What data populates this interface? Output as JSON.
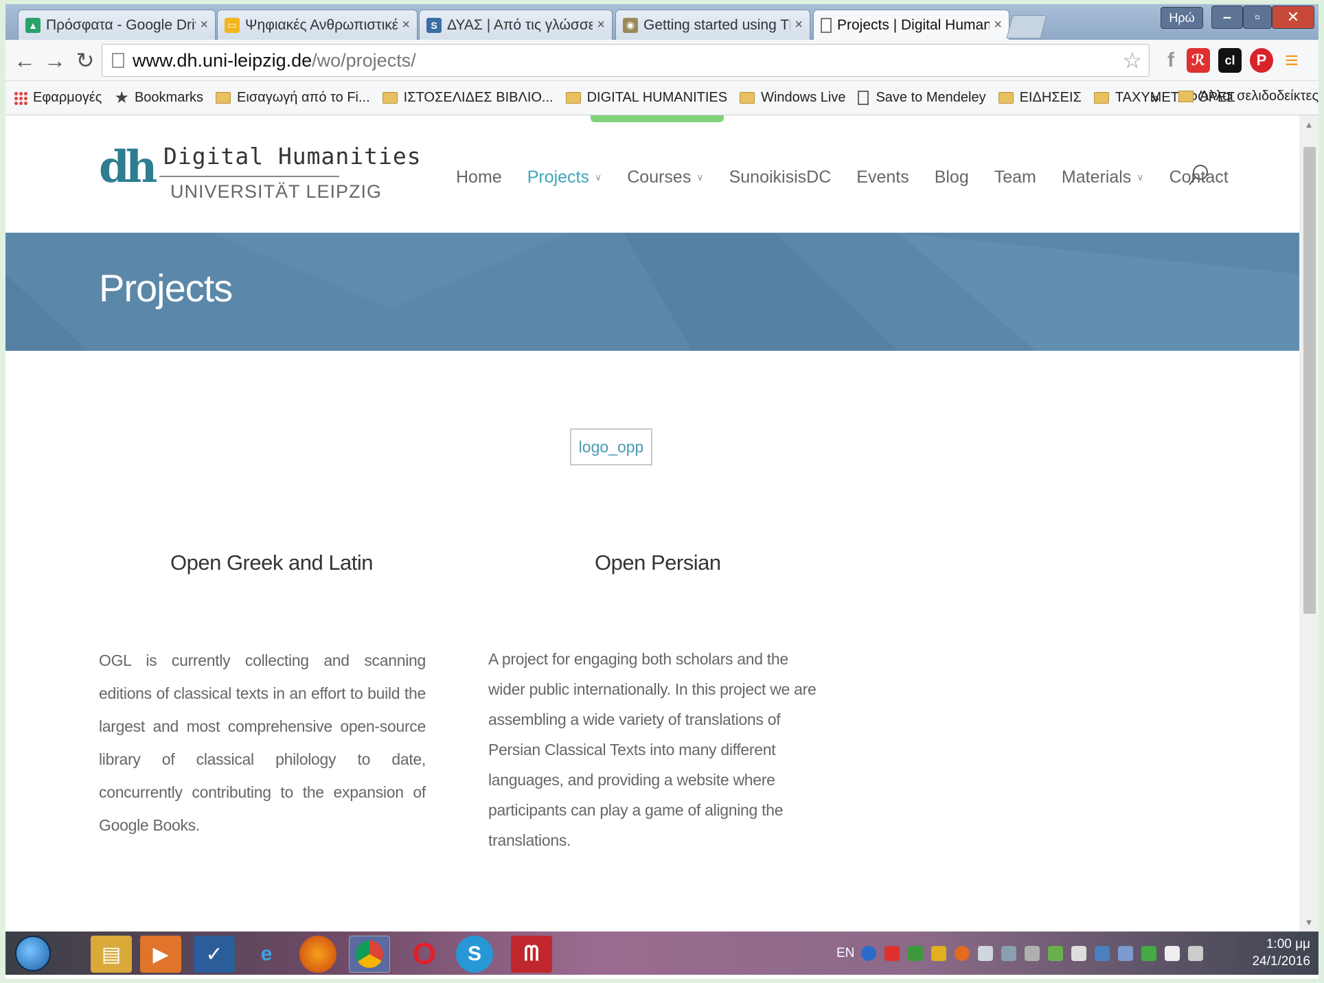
{
  "browser": {
    "tabs": [
      {
        "title": "Πρόσφατα - Google Drive",
        "icon": "google-drive-icon",
        "color": "#2aa26a"
      },
      {
        "title": "Ψηφιακές Ανθρωπιστικές",
        "icon": "slides-icon",
        "color": "#f2b51c"
      },
      {
        "title": "ΔΥΑΣ | Από τις γλώσσες σ",
        "icon": "s-logo-icon",
        "color": "#3b6ea5"
      },
      {
        "title": "Getting started using TEI",
        "icon": "tei-icon",
        "color": "#9a8a5a"
      },
      {
        "title": "Projects | Digital Humaniti",
        "icon": "page-icon",
        "color": "#ffffff"
      }
    ],
    "user_badge": "Ηρώ",
    "address": {
      "host": "www.dh.uni-leipzig.de",
      "path": "/wo/projects/"
    },
    "bookmarks": [
      {
        "label": "Εφαρμογές",
        "icon": "apps-icon"
      },
      {
        "label": "Bookmarks",
        "icon": "star-icon"
      },
      {
        "label": "Εισαγωγή από το Fi...",
        "icon": "folder-icon"
      },
      {
        "label": "ΙΣΤΟΣΕΛΙΔΕΣ ΒΙΒΛΙΟ...",
        "icon": "folder-icon"
      },
      {
        "label": "DIGITAL HUMANITIES",
        "icon": "folder-icon"
      },
      {
        "label": "Windows Live",
        "icon": "folder-icon"
      },
      {
        "label": "Save to Mendeley",
        "icon": "doc-icon"
      },
      {
        "label": "ΕΙΔΗΣΕΙΣ",
        "icon": "folder-icon"
      },
      {
        "label": "ΤΑΧΥΜΕΤΑΦΟΡΕΣ",
        "icon": "folder-icon"
      }
    ],
    "bookmarks_overflow": "»",
    "other_bookmarks": "Άλλοι σελιδοδείκτες"
  },
  "site": {
    "logo_mark": "dh",
    "logo_title": "Digital Humanities",
    "logo_subtitle": "UNIVERSITÄT LEIPZIG",
    "nav": [
      {
        "label": "Home",
        "has_caret": false,
        "active": false
      },
      {
        "label": "Projects",
        "has_caret": true,
        "active": true
      },
      {
        "label": "Courses",
        "has_caret": true,
        "active": false
      },
      {
        "label": "SunoikisisDC",
        "has_caret": false,
        "active": false
      },
      {
        "label": "Events",
        "has_caret": false,
        "active": false
      },
      {
        "label": "Blog",
        "has_caret": false,
        "active": false
      },
      {
        "label": "Team",
        "has_caret": false,
        "active": false
      },
      {
        "label": "Materials",
        "has_caret": true,
        "active": false
      },
      {
        "label": "Contact",
        "has_caret": false,
        "active": false
      }
    ],
    "accent_color": "#3ea7b9",
    "hero_title": "Projects",
    "hero_color": "#5b87a9",
    "broken_image_alt": "logo_opp",
    "projects": [
      {
        "title": "Open Greek and Latin",
        "text": "OGL is currently collecting and scanning editions of classical texts in an effort to build the largest and most comprehensive open-source library of classical philology to date, concurrently contributing to the expansion of Google Books."
      },
      {
        "title": "Open Persian",
        "text": "A project for engaging both scholars and the wider public internationally. In this project we are assembling a wide variety of translations of Persian Classical Texts into many different languages, and providing a website where participants can play a game of aligning the translations."
      }
    ]
  },
  "taskbar": {
    "language": "EN",
    "time": "1:00 μμ",
    "date": "24/1/2016"
  }
}
